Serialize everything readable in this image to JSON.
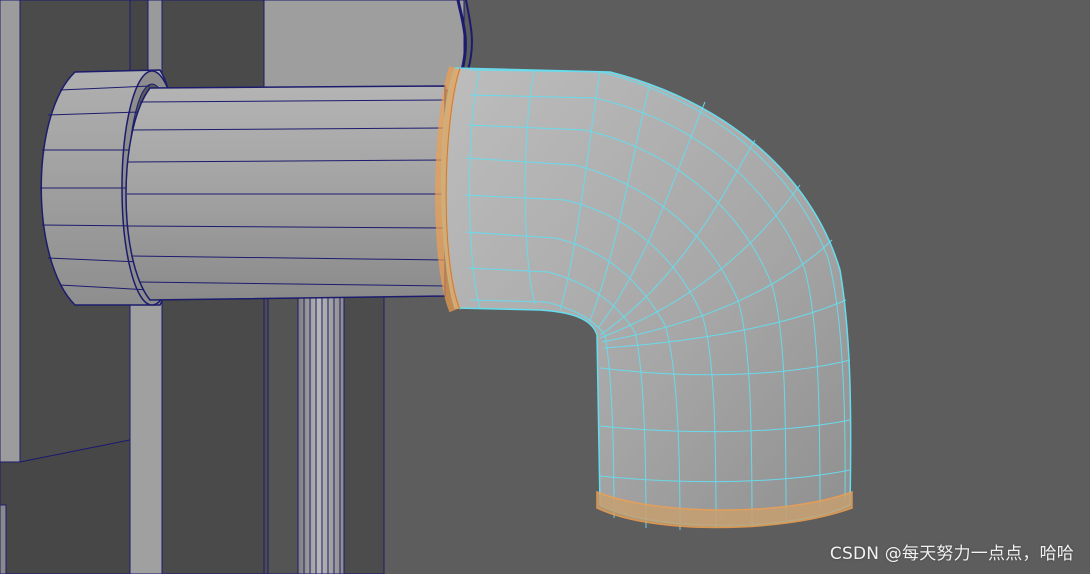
{
  "viewport": {
    "background_color": "#5d5d5d",
    "wire_color": "#1c1c6e",
    "selected_wire_color": "#66ddee",
    "selected_border_color": "#f0a050"
  },
  "objects": [
    {
      "name": "wall-panel",
      "selected": false
    },
    {
      "name": "flange-cylinder",
      "selected": false
    },
    {
      "name": "horizontal-pipe",
      "selected": false
    },
    {
      "name": "vertical-post",
      "selected": false
    },
    {
      "name": "elbow-pipe",
      "selected": true
    }
  ],
  "watermark": {
    "text": "CSDN @每天努力一点点，哈哈"
  }
}
